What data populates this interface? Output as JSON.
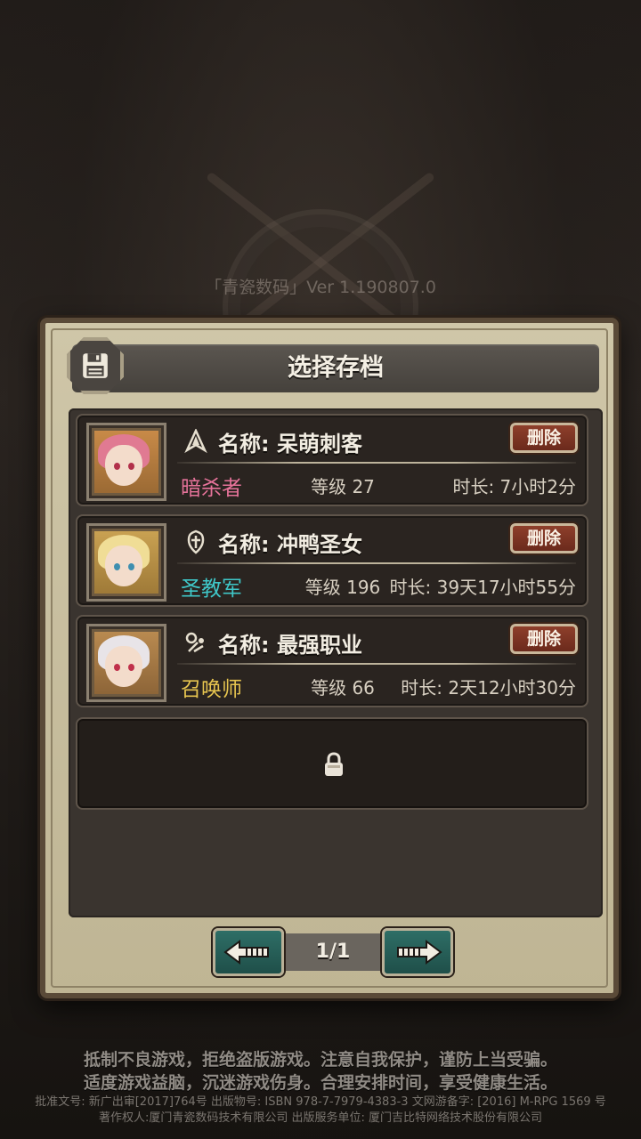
{
  "version_text": "「青瓷数码」Ver 1.190807.0",
  "dialog": {
    "title": "选择存档",
    "save_icon": "floppy-disk-icon"
  },
  "slots": [
    {
      "name": "名称: 呆萌刺客",
      "delete_label": "删除",
      "class_name": "暗杀者",
      "class_color": "#e6739a",
      "class_icon": "assassin-icon",
      "level": "等级 27",
      "duration": "时长: 7小时2分",
      "hair_color": "#e07a92"
    },
    {
      "name": "名称: 冲鸭圣女",
      "delete_label": "删除",
      "class_name": "圣教军",
      "class_color": "#3fc7c8",
      "class_icon": "holy-shield-icon",
      "level": "等级 196",
      "duration": "时长: 39天17小时55分",
      "hair_color": "#f0dd96"
    },
    {
      "name": "名称: 最强职业",
      "delete_label": "删除",
      "class_name": "召唤师",
      "class_color": "#e6c44f",
      "class_icon": "summoner-icon",
      "level": "等级 66",
      "duration": "时长: 2天12小时30分",
      "hair_color": "#e8e4e8"
    }
  ],
  "locked_slot_icon": "lock-icon",
  "pager": {
    "page": "1/1",
    "prev_icon": "arrow-left-icon",
    "next_icon": "arrow-right-icon"
  },
  "footer": {
    "notice1": "抵制不良游戏，拒绝盗版游戏。注意自我保护，谨防上当受骗。",
    "notice2": "适度游戏益脑，沉迷游戏伤身。合理安排时间，享受健康生活。",
    "legal1": "批准文号: 新广出审[2017]764号 出版物号: ISBN 978-7-7979-4383-3 文网游备字: [2016] M-RPG 1569 号",
    "legal2": "著作权人:厦门青瓷数码技术有限公司 出版服务单位: 厦门吉比特网络技术股份有限公司"
  }
}
